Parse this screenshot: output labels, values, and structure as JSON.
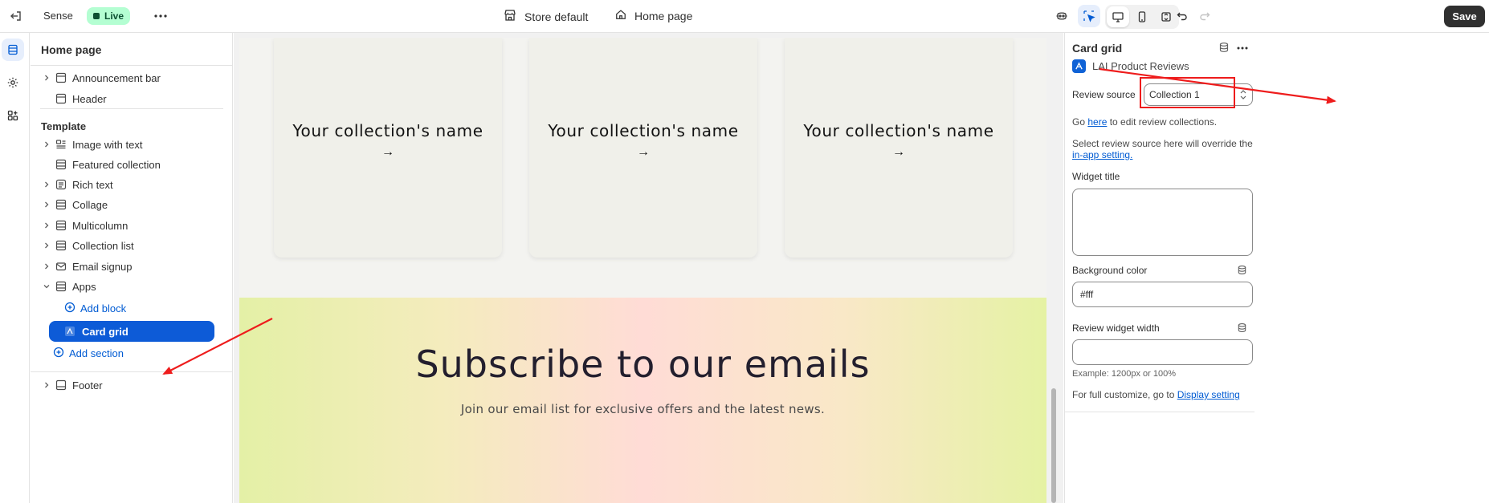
{
  "topbar": {
    "theme_name": "Sense",
    "live_label": "Live",
    "store_label": "Store default",
    "page_label": "Home page",
    "save_label": "Save"
  },
  "sidebar": {
    "title": "Home page",
    "header_items": [
      {
        "label": "Announcement bar",
        "icon": "section-icon",
        "expandable": true
      },
      {
        "label": "Header",
        "icon": "section-icon",
        "expandable": false
      }
    ],
    "template_label": "Template",
    "template_items": [
      {
        "label": "Image with text",
        "icon": "image-text-icon",
        "expandable": true
      },
      {
        "label": "Featured collection",
        "icon": "section-icon",
        "expandable": false
      },
      {
        "label": "Rich text",
        "icon": "text-icon",
        "expandable": true
      },
      {
        "label": "Collage",
        "icon": "section-icon",
        "expandable": true
      },
      {
        "label": "Multicolumn",
        "icon": "section-icon",
        "expandable": true
      },
      {
        "label": "Collection list",
        "icon": "section-icon",
        "expandable": true
      },
      {
        "label": "Email signup",
        "icon": "email-icon",
        "expandable": true
      },
      {
        "label": "Apps",
        "icon": "section-icon",
        "expandable": true,
        "expanded": true
      }
    ],
    "add_block_label": "Add block",
    "selected_block_label": "Card grid",
    "add_section_label": "Add section",
    "footer_label": "Footer"
  },
  "canvas": {
    "cards": [
      {
        "title": "Your collection's name",
        "arrow": "→"
      },
      {
        "title": "Your collection's name",
        "arrow": "→"
      },
      {
        "title": "Your collection's name",
        "arrow": "→"
      }
    ],
    "subscribe_title": "Subscribe to our emails",
    "subscribe_text": "Join our email list for exclusive offers and the latest news."
  },
  "settings": {
    "title": "Card grid",
    "app_name": "LAI Product Reviews",
    "review_source_label": "Review source",
    "review_source_value": "Collection 1",
    "help_go_prefix": "Go ",
    "help_go_link": "here",
    "help_go_suffix": " to edit review collections.",
    "help_override_text": "Select review source here will override the",
    "help_override_link": "in-app setting.",
    "widget_title_label": "Widget title",
    "widget_title_value": "",
    "background_color_label": "Background color",
    "background_color_value": "#fff",
    "review_widget_width_label": "Review widget width",
    "review_widget_width_value": "",
    "width_example": "Example: 1200px or 100%",
    "customize_prefix": "For full customize, go to ",
    "customize_link": "Display setting"
  },
  "colors": {
    "accent": "#005bd3",
    "selected_bg": "#0d5bd7",
    "live_badge_bg": "#b4fed2",
    "annotation_red": "#ee1c1c"
  }
}
